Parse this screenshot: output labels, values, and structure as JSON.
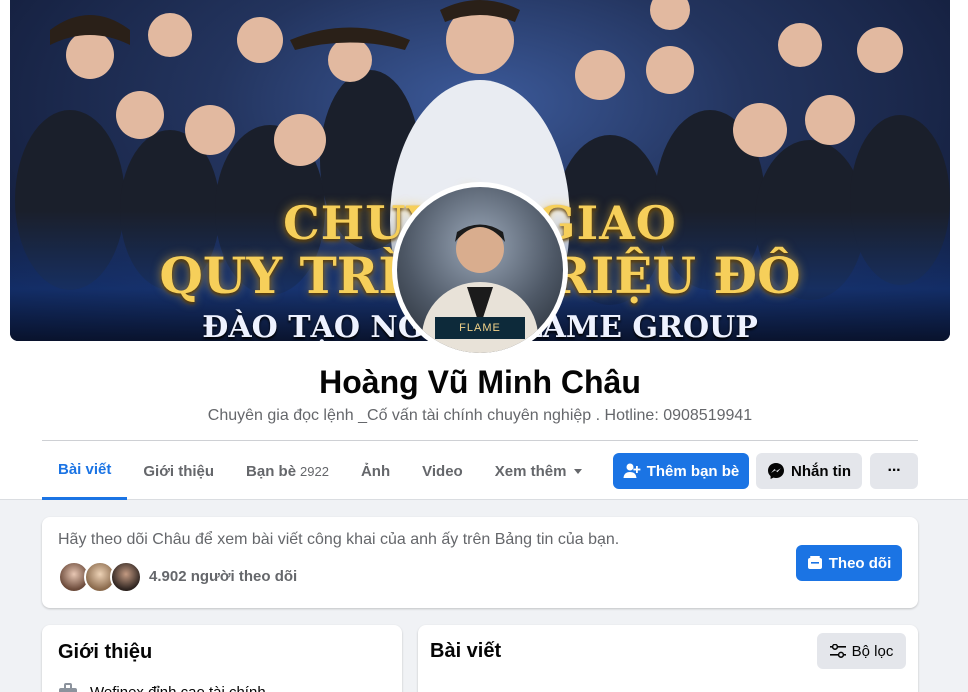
{
  "profile": {
    "name": "Hoàng Vũ Minh Châu",
    "bio": "Chuyên gia đọc lệnh _Cố vấn tài chính chuyên nghiệp . Hotline: 0908519941"
  },
  "cover": {
    "line1": "CHUYỂN GIAO",
    "line2": "QUY TRÌNH TRIỆU ĐÔ",
    "line3": "ĐÀO TẠO NGƯỜI FLAME GROUP",
    "avatar_badge": "FLAME"
  },
  "tabs": [
    {
      "label": "Bài viết",
      "active": true
    },
    {
      "label": "Giới thiệu"
    },
    {
      "label": "Bạn bè",
      "count": "2922"
    },
    {
      "label": "Ảnh"
    },
    {
      "label": "Video"
    },
    {
      "label": "Xem thêm"
    }
  ],
  "actions": {
    "add_friend": "Thêm bạn bè",
    "message": "Nhắn tin",
    "more": "···"
  },
  "follow_card": {
    "text": "Hãy theo dõi Châu để xem bài viết công khai của anh ấy trên Bảng tin của bạn.",
    "followers": "4.902 người theo dõi",
    "follow_button": "Theo dõi"
  },
  "intro": {
    "title": "Giới thiệu",
    "work": "Wefinex đỉnh cao tài chính"
  },
  "posts": {
    "title": "Bài viết",
    "filter_button": "Bộ lọc"
  },
  "colors": {
    "accent": "#1b74e4",
    "background": "#f0f2f5",
    "secondary_text": "#65676b"
  }
}
